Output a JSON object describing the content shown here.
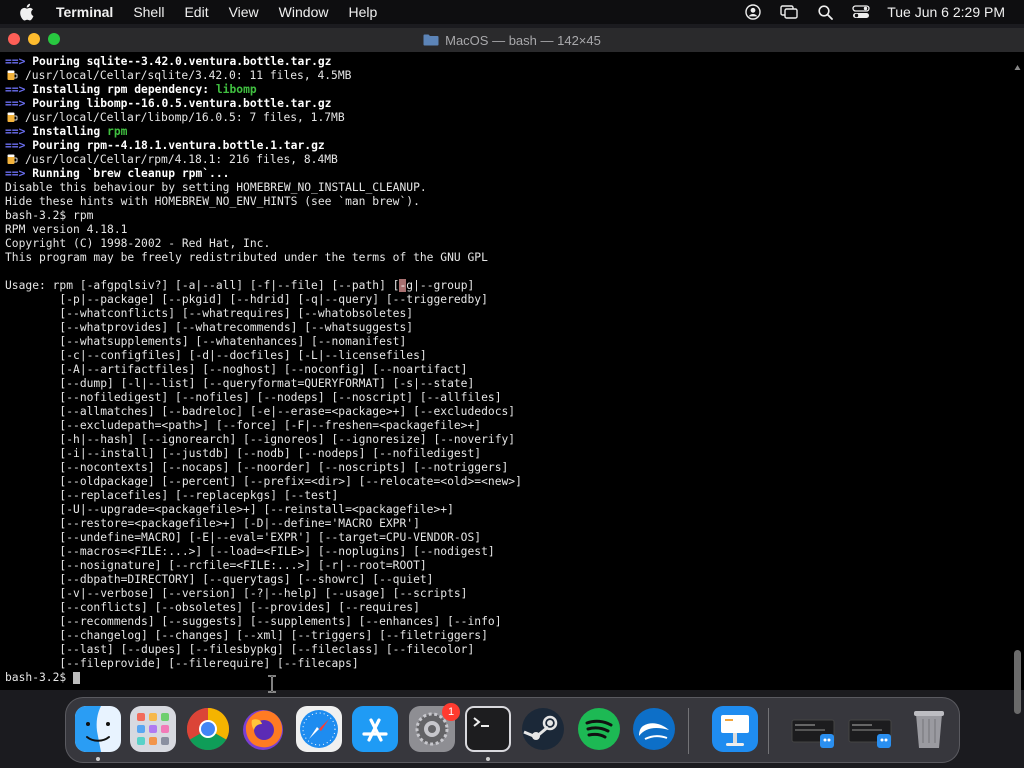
{
  "menubar": {
    "app": "Terminal",
    "menus": [
      "Shell",
      "Edit",
      "View",
      "Window",
      "Help"
    ],
    "clock": "Tue Jun 6  2:29 PM"
  },
  "window": {
    "title": "MacOS — bash — 142×45"
  },
  "terminal": {
    "lines": [
      {
        "type": "arrow",
        "text": "Pouring sqlite--3.42.0.ventura.bottle.tar.gz"
      },
      {
        "type": "beer",
        "text": "/usr/local/Cellar/sqlite/3.42.0: 11 files, 4.5MB"
      },
      {
        "type": "arrow-dep",
        "text": "Installing rpm dependency: ",
        "highlight": "libomp"
      },
      {
        "type": "arrow",
        "text": "Pouring libomp--16.0.5.ventura.bottle.tar.gz"
      },
      {
        "type": "beer",
        "text": "/usr/local/Cellar/libomp/16.0.5: 7 files, 1.7MB"
      },
      {
        "type": "arrow-dep",
        "text": "Installing ",
        "highlight": "rpm"
      },
      {
        "type": "arrow",
        "text": "Pouring rpm--4.18.1.ventura.bottle.1.tar.gz"
      },
      {
        "type": "beer",
        "text": "/usr/local/Cellar/rpm/4.18.1: 216 files, 8.4MB"
      },
      {
        "type": "arrow",
        "text": "Running `brew cleanup rpm`..."
      },
      {
        "type": "plain",
        "text": "Disable this behaviour by setting HOMEBREW_NO_INSTALL_CLEANUP."
      },
      {
        "type": "plain",
        "text": "Hide these hints with HOMEBREW_NO_ENV_HINTS (see `man brew`)."
      },
      {
        "type": "plain",
        "text": "bash-3.2$ rpm"
      },
      {
        "type": "plain",
        "text": "RPM version 4.18.1"
      },
      {
        "type": "plain",
        "text": "Copyright (C) 1998-2002 - Red Hat, Inc."
      },
      {
        "type": "plain",
        "text": "This program may be freely redistributed under the terms of the GNU GPL"
      },
      {
        "type": "plain",
        "text": ""
      },
      {
        "type": "usage",
        "text": "Usage: rpm [-afgpqlsiv?] [-a|--all] [-f|--file] [--path] [",
        "mark": "-",
        "rest": "g|--group]"
      },
      {
        "type": "plain",
        "text": "        [-p|--package] [--pkgid] [--hdrid] [-q|--query] [--triggeredby]"
      },
      {
        "type": "plain",
        "text": "        [--whatconflicts] [--whatrequires] [--whatobsoletes]"
      },
      {
        "type": "plain",
        "text": "        [--whatprovides] [--whatrecommends] [--whatsuggests]"
      },
      {
        "type": "plain",
        "text": "        [--whatsupplements] [--whatenhances] [--nomanifest]"
      },
      {
        "type": "plain",
        "text": "        [-c|--configfiles] [-d|--docfiles] [-L|--licensefiles]"
      },
      {
        "type": "plain",
        "text": "        [-A|--artifactfiles] [--noghost] [--noconfig] [--noartifact]"
      },
      {
        "type": "plain",
        "text": "        [--dump] [-l|--list] [--queryformat=QUERYFORMAT] [-s|--state]"
      },
      {
        "type": "plain",
        "text": "        [--nofiledigest] [--nofiles] [--nodeps] [--noscript] [--allfiles]"
      },
      {
        "type": "plain",
        "text": "        [--allmatches] [--badreloc] [-e|--erase=<package>+] [--excludedocs]"
      },
      {
        "type": "plain",
        "text": "        [--excludepath=<path>] [--force] [-F|--freshen=<packagefile>+]"
      },
      {
        "type": "plain",
        "text": "        [-h|--hash] [--ignorearch] [--ignoreos] [--ignoresize] [--noverify]"
      },
      {
        "type": "plain",
        "text": "        [-i|--install] [--justdb] [--nodb] [--nodeps] [--nofiledigest]"
      },
      {
        "type": "plain",
        "text": "        [--nocontexts] [--nocaps] [--noorder] [--noscripts] [--notriggers]"
      },
      {
        "type": "plain",
        "text": "        [--oldpackage] [--percent] [--prefix=<dir>] [--relocate=<old>=<new>]"
      },
      {
        "type": "plain",
        "text": "        [--replacefiles] [--replacepkgs] [--test]"
      },
      {
        "type": "plain",
        "text": "        [-U|--upgrade=<packagefile>+] [--reinstall=<packagefile>+]"
      },
      {
        "type": "plain",
        "text": "        [--restore=<packagefile>+] [-D|--define='MACRO EXPR']"
      },
      {
        "type": "plain",
        "text": "        [--undefine=MACRO] [-E|--eval='EXPR'] [--target=CPU-VENDOR-OS]"
      },
      {
        "type": "plain",
        "text": "        [--macros=<FILE:...>] [--load=<FILE>] [--noplugins] [--nodigest]"
      },
      {
        "type": "plain",
        "text": "        [--nosignature] [--rcfile=<FILE:...>] [-r|--root=ROOT]"
      },
      {
        "type": "plain",
        "text": "        [--dbpath=DIRECTORY] [--querytags] [--showrc] [--quiet]"
      },
      {
        "type": "plain",
        "text": "        [-v|--verbose] [--version] [-?|--help] [--usage] [--scripts]"
      },
      {
        "type": "plain",
        "text": "        [--conflicts] [--obsoletes] [--provides] [--requires]"
      },
      {
        "type": "plain",
        "text": "        [--recommends] [--suggests] [--supplements] [--enhances] [--info]"
      },
      {
        "type": "plain",
        "text": "        [--changelog] [--changes] [--xml] [--triggers] [--filetriggers]"
      },
      {
        "type": "plain",
        "text": "        [--last] [--dupes] [--filesbypkg] [--fileclass] [--filecolor]"
      },
      {
        "type": "plain",
        "text": "        [--fileprovide] [--filerequire] [--filecaps]"
      },
      {
        "type": "prompt",
        "text": "bash-3.2$ "
      }
    ]
  },
  "dock": {
    "items": [
      {
        "name": "finder",
        "icon": "finder-icon",
        "running": true
      },
      {
        "name": "launchpad",
        "icon": "launchpad-icon",
        "running": false
      },
      {
        "name": "chrome",
        "icon": "chrome-icon",
        "running": false
      },
      {
        "name": "firefox",
        "icon": "firefox-icon",
        "running": false
      },
      {
        "name": "safari",
        "icon": "safari-icon",
        "running": false
      },
      {
        "name": "app-store",
        "icon": "app-store-icon",
        "running": false
      },
      {
        "name": "system-settings",
        "icon": "settings-icon",
        "running": false,
        "badge": "1"
      },
      {
        "name": "terminal",
        "icon": "terminal-icon",
        "running": true
      },
      {
        "name": "steam",
        "icon": "steam-icon",
        "running": false
      },
      {
        "name": "spotify",
        "icon": "spotify-icon",
        "running": false
      },
      {
        "name": "openoffice",
        "icon": "openoffice-icon",
        "running": false
      },
      {
        "name": "keynote",
        "icon": "keynote-icon",
        "running": false
      },
      {
        "name": "window-thumbnail-1",
        "icon": "window-thumbnail-icon",
        "running": false
      },
      {
        "name": "window-thumbnail-2",
        "icon": "window-thumbnail-icon",
        "running": false
      },
      {
        "name": "trash",
        "icon": "trash-icon",
        "running": false
      }
    ]
  },
  "colors": {
    "arrow": "#6a6ef0",
    "green": "#40c040",
    "badge": "#ff3b30"
  }
}
